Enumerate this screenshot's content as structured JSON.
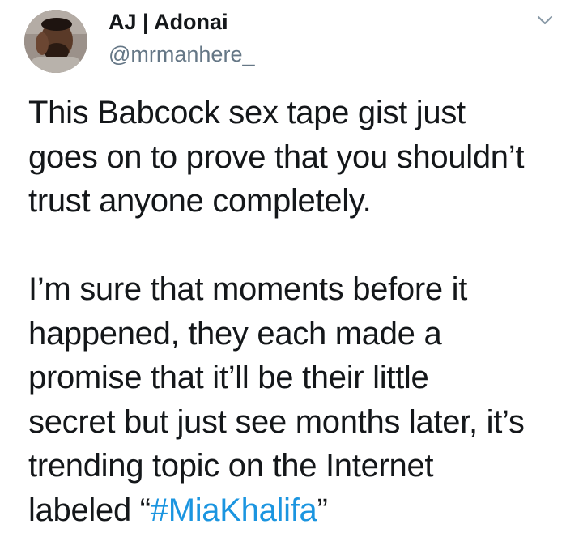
{
  "author": {
    "display_name": "AJ | Adonai",
    "handle": "@mrmanhere_"
  },
  "menu": {
    "icon": "chevron-down-icon"
  },
  "tweet": {
    "paragraph1": {
      "line1": "This Babcock sex tape gist just",
      "line2": "goes on to prove that you shouldn’t",
      "line3": "trust anyone completely."
    },
    "paragraph2": {
      "line1": "I’m sure that moments before it",
      "line2": "happened, they each made a",
      "line3": "promise that it’ll be their little",
      "line4": "secret but just see months later, it’s",
      "line5": "trending topic on the Internet",
      "line6_prefix": "labeled “",
      "hashtag": "#MiaKhalifa",
      "line6_suffix": "”"
    }
  },
  "colors": {
    "hashtag": "#1b95e0",
    "handle": "#657786",
    "text": "#14171a"
  }
}
